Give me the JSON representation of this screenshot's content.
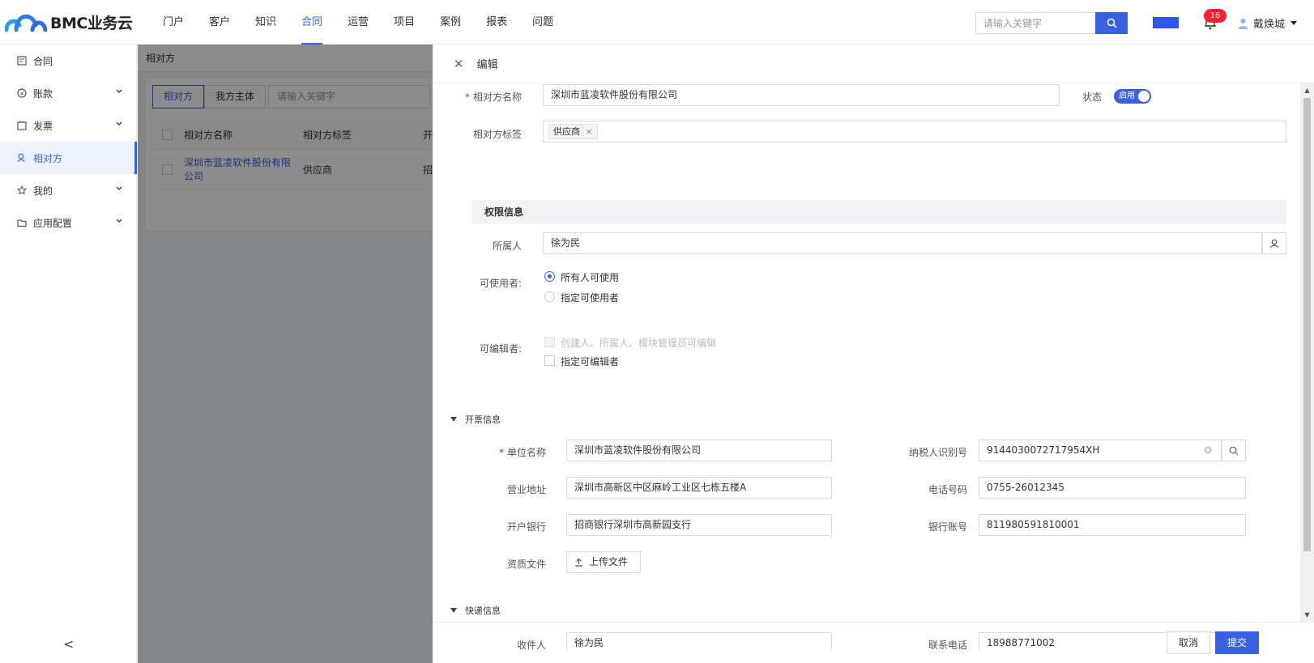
{
  "header": {
    "brand": "BMC业务云",
    "nav": [
      "门户",
      "客户",
      "知识",
      "合同",
      "运营",
      "项目",
      "案例",
      "报表",
      "问题"
    ],
    "active_nav_index": 3,
    "search_placeholder": "请输入关键字",
    "notification_count": "16",
    "user_name": "戴焕城"
  },
  "sidebar": {
    "items": [
      {
        "label": "合同",
        "icon": "contract-icon",
        "expandable": false
      },
      {
        "label": "账款",
        "icon": "money-icon",
        "expandable": true
      },
      {
        "label": "发票",
        "icon": "invoice-icon",
        "expandable": true
      },
      {
        "label": "相对方",
        "icon": "person-icon",
        "expandable": false,
        "active": true
      },
      {
        "label": "我的",
        "icon": "star-icon",
        "expandable": true
      },
      {
        "label": "应用配置",
        "icon": "folder-icon",
        "expandable": true
      }
    ],
    "collapse_glyph": "<"
  },
  "main": {
    "breadcrumb": "相对方",
    "tabs": [
      "相对方",
      "我方主体"
    ],
    "search_placeholder": "请输入关键字",
    "columns": [
      "相对方名称",
      "相对方标签"
    ],
    "rows": [
      {
        "name": "深圳市蓝凌软件股份有限公司",
        "tag": "供应商"
      }
    ]
  },
  "drawer": {
    "title": "编辑",
    "basic": {
      "name_label": "相对方名称",
      "name_value": "深圳市蓝凌软件股份有限公司",
      "status_label": "状态",
      "status_value": "启用",
      "tag_label": "相对方标签",
      "tags": [
        "供应商"
      ]
    },
    "permission": {
      "section_title": "权限信息",
      "owner_label": "所属人",
      "owner_value": "徐为民",
      "users_label": "可使用者:",
      "users_options": [
        "所有人可使用",
        "指定可使用者"
      ],
      "editors_label": "可编辑者:",
      "editors_options": [
        "创建人、所属人、模块管理员可编辑",
        "指定可编辑者"
      ]
    },
    "invoice": {
      "section_title": "开票信息",
      "unit_label": "单位名称",
      "unit_value": "深圳市蓝凌软件股份有限公司",
      "tax_label": "纳税人识别号",
      "tax_value": "9144030072717954XH",
      "address_label": "营业地址",
      "address_value": "深圳市高新区中区麻岭工业区七栋五楼A",
      "phone_label": "电话号码",
      "phone_value": "0755-26012345",
      "bank_label": "开户银行",
      "bank_value": "招商银行深圳市高新园支行",
      "account_label": "银行账号",
      "account_value": "811980591810001",
      "file_label": "资质文件",
      "upload_label": "上传文件"
    },
    "express": {
      "section_title": "快递信息",
      "receiver_label": "收件人",
      "receiver_value": "徐为民",
      "contact_label": "联系电话",
      "contact_value": "18988771002"
    },
    "footer": {
      "cancel": "取消",
      "submit": "提交"
    }
  },
  "colors": {
    "accent": "#3a62e0",
    "badge": "#f5222d"
  }
}
